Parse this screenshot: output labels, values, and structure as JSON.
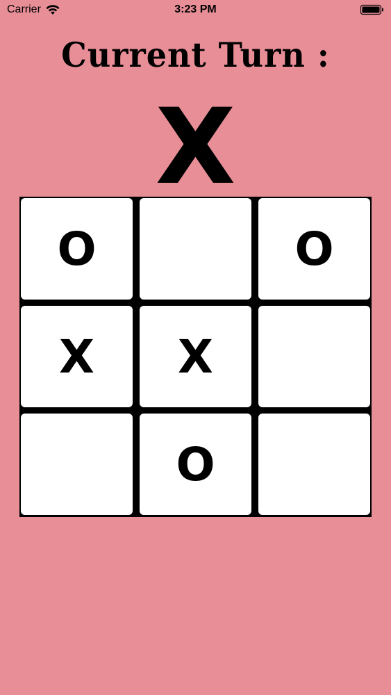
{
  "status_bar": {
    "carrier": "Carrier",
    "time": "3:23 PM"
  },
  "game": {
    "title": "Current Turn :",
    "current_symbol": "X",
    "board": [
      [
        "O",
        "",
        "O"
      ],
      [
        "X",
        "X",
        ""
      ],
      [
        "",
        "O",
        ""
      ]
    ]
  },
  "colors": {
    "background": "#E88E97",
    "cell": "#FFFFFF",
    "grid": "#000000"
  },
  "icons": {
    "wifi": "wifi-icon",
    "battery": "battery-icon"
  }
}
